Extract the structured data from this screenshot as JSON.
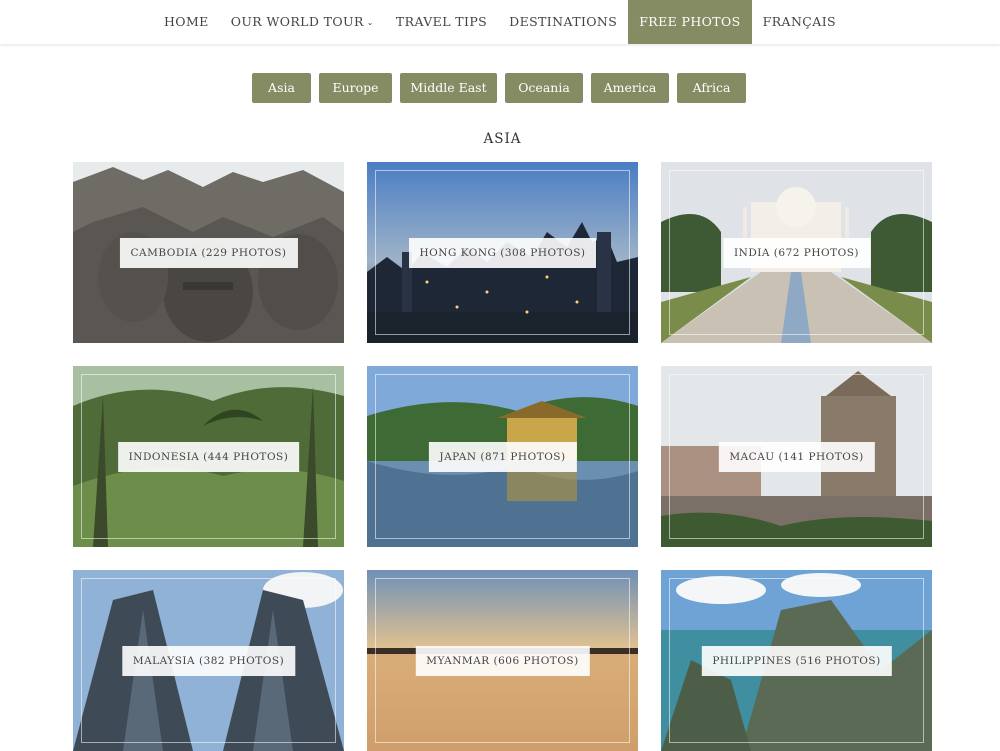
{
  "nav": {
    "items": [
      {
        "label": "HOME"
      },
      {
        "label": "OUR WORLD TOUR"
      },
      {
        "label": "TRAVEL TIPS"
      },
      {
        "label": "DESTINATIONS"
      },
      {
        "label": "FREE PHOTOS"
      },
      {
        "label": "FRANÇAIS"
      }
    ],
    "active_index": 4
  },
  "filters": [
    "Asia",
    "Europe",
    "Middle East",
    "Oceania",
    "America",
    "Africa"
  ],
  "section_title": "ASIA",
  "cards": [
    {
      "label": "CAMBODIA (229 PHOTOS)"
    },
    {
      "label": "HONG KONG (308 PHOTOS)"
    },
    {
      "label": "INDIA (672 PHOTOS)"
    },
    {
      "label": "INDONESIA (444 PHOTOS)"
    },
    {
      "label": "JAPAN (871 PHOTOS)"
    },
    {
      "label": "MACAU (141 PHOTOS)"
    },
    {
      "label": "MALAYSIA (382 PHOTOS)"
    },
    {
      "label": "MYANMAR (606 PHOTOS)"
    },
    {
      "label": "PHILIPPINES (516 PHOTOS)"
    }
  ],
  "colors": {
    "accent": "#858c63",
    "text": "#444444"
  }
}
